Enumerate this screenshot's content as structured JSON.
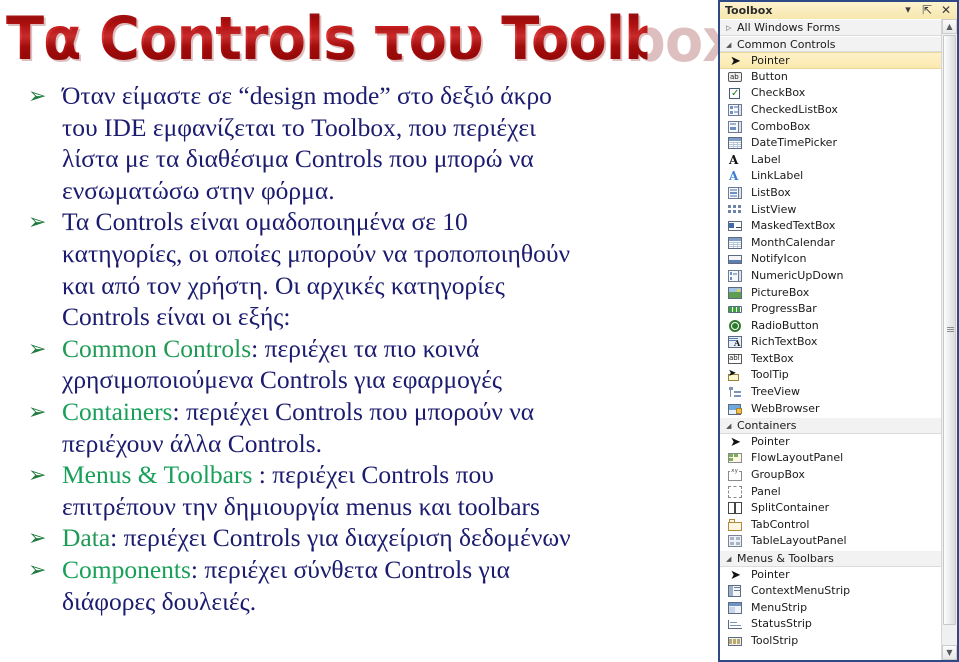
{
  "slide": {
    "title": "Τα Controls του Toolbox",
    "bullets": [
      {
        "mark": "➢",
        "lines": [
          "Όταν είμαστε σε “design mode” στο δεξιό άκρο",
          "του IDE εμφανίζεται το Toolbox, που περιέχει",
          "λίστα με τα διαθέσιμα Controls που μπορώ να",
          "ενσωματώσω στην φόρμα."
        ]
      },
      {
        "mark": "➢",
        "lines": [
          "Τα Controls είναι ομαδοποιημένα σε 10",
          "κατηγορίες, οι οποίες μπορούν να τροποποιηθούν",
          "και από τον χρήστη. Οι αρχικές κατηγορίες",
          "Controls είναι οι εξής:"
        ]
      },
      {
        "mark": "➢",
        "category": "Common Controls",
        "lines": [
          ": περιέχει τα πιο κοινά",
          "χρησιμοποιούμενα Controls για εφαρμογές"
        ]
      },
      {
        "mark": "➢",
        "category": "Containers",
        "lines": [
          ": περιέχει Controls που μπορούν να",
          "περιέχουν άλλα Controls."
        ]
      },
      {
        "mark": "➢",
        "category": "Menus & Toolbars",
        "lines": [
          " : περιέχει Controls που",
          "επιτρέπουν την δημιουργία menus και toolbars"
        ]
      },
      {
        "mark": "➢",
        "category": "Data",
        "lines": [
          ": περιέχει Controls για διαχείριση δεδομένων"
        ]
      },
      {
        "mark": "➢",
        "category": "Components",
        "lines": [
          ": περιέχει σύνθετα Controls για",
          "διάφορες δουλειές."
        ]
      }
    ],
    "colors": {
      "title_red": "#b01010",
      "body_navy": "#1b1b6f",
      "bullet_green": "#1f7a3d",
      "category_green": "#1f9a55"
    }
  },
  "toolbox": {
    "title": "Toolbox",
    "header_buttons": [
      {
        "name": "dropdown",
        "glyph": "▾"
      },
      {
        "name": "pin",
        "glyph": "⇱"
      },
      {
        "name": "close",
        "glyph": "✕"
      }
    ],
    "rows": [
      {
        "kind": "group",
        "label": "All Windows Forms",
        "tri": "▷",
        "expanded": false
      },
      {
        "kind": "group",
        "label": "Common Controls",
        "tri": "◢",
        "expanded": true
      },
      {
        "kind": "item",
        "label": "Pointer",
        "icon": "pointer-icon",
        "selected": true
      },
      {
        "kind": "item",
        "label": "Button",
        "icon": "button-icon"
      },
      {
        "kind": "item",
        "label": "CheckBox",
        "icon": "checkbox-icon"
      },
      {
        "kind": "item",
        "label": "CheckedListBox",
        "icon": "checkedlistbox-icon"
      },
      {
        "kind": "item",
        "label": "ComboBox",
        "icon": "combobox-icon"
      },
      {
        "kind": "item",
        "label": "DateTimePicker",
        "icon": "datetimepicker-icon"
      },
      {
        "kind": "item",
        "label": "Label",
        "icon": "label-icon"
      },
      {
        "kind": "item",
        "label": "LinkLabel",
        "icon": "linklabel-icon"
      },
      {
        "kind": "item",
        "label": "ListBox",
        "icon": "listbox-icon"
      },
      {
        "kind": "item",
        "label": "ListView",
        "icon": "listview-icon"
      },
      {
        "kind": "item",
        "label": "MaskedTextBox",
        "icon": "maskedtextbox-icon"
      },
      {
        "kind": "item",
        "label": "MonthCalendar",
        "icon": "monthcalendar-icon"
      },
      {
        "kind": "item",
        "label": "NotifyIcon",
        "icon": "notifyicon-icon"
      },
      {
        "kind": "item",
        "label": "NumericUpDown",
        "icon": "numericupdown-icon"
      },
      {
        "kind": "item",
        "label": "PictureBox",
        "icon": "picturebox-icon"
      },
      {
        "kind": "item",
        "label": "ProgressBar",
        "icon": "progressbar-icon"
      },
      {
        "kind": "item",
        "label": "RadioButton",
        "icon": "radiobutton-icon"
      },
      {
        "kind": "item",
        "label": "RichTextBox",
        "icon": "richtextbox-icon"
      },
      {
        "kind": "item",
        "label": "TextBox",
        "icon": "textbox-icon"
      },
      {
        "kind": "item",
        "label": "ToolTip",
        "icon": "tooltip-icon"
      },
      {
        "kind": "item",
        "label": "TreeView",
        "icon": "treeview-icon"
      },
      {
        "kind": "item",
        "label": "WebBrowser",
        "icon": "webbrowser-icon"
      },
      {
        "kind": "group",
        "label": "Containers",
        "tri": "◢",
        "expanded": true
      },
      {
        "kind": "item",
        "label": "Pointer",
        "icon": "pointer-icon"
      },
      {
        "kind": "item",
        "label": "FlowLayoutPanel",
        "icon": "flowlayoutpanel-icon"
      },
      {
        "kind": "item",
        "label": "GroupBox",
        "icon": "groupbox-icon"
      },
      {
        "kind": "item",
        "label": "Panel",
        "icon": "panel-icon"
      },
      {
        "kind": "item",
        "label": "SplitContainer",
        "icon": "splitcontainer-icon"
      },
      {
        "kind": "item",
        "label": "TabControl",
        "icon": "tabcontrol-icon"
      },
      {
        "kind": "item",
        "label": "TableLayoutPanel",
        "icon": "tablelayoutpanel-icon"
      },
      {
        "kind": "group",
        "label": "Menus & Toolbars",
        "tri": "◢",
        "expanded": true
      },
      {
        "kind": "item",
        "label": "Pointer",
        "icon": "pointer-icon"
      },
      {
        "kind": "item",
        "label": "ContextMenuStrip",
        "icon": "contextmenustrip-icon"
      },
      {
        "kind": "item",
        "label": "MenuStrip",
        "icon": "menustrip-icon"
      },
      {
        "kind": "item",
        "label": "StatusStrip",
        "icon": "statusstrip-icon"
      },
      {
        "kind": "item",
        "label": "ToolStrip",
        "icon": "toolstrip-icon"
      }
    ],
    "scrollbar": {
      "up": "▲",
      "down": "▼"
    },
    "colors": {
      "border": "#2e4a86",
      "header_bg": "#f6e7ad",
      "selection_bg": "#fbe9ae",
      "group_bg": "#f2f2f2"
    }
  }
}
